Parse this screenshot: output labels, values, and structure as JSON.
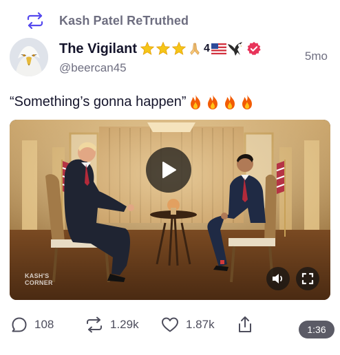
{
  "retruth": {
    "icon": "retruth-icon",
    "label": "Kash Patel ReTruthed"
  },
  "author": {
    "avatar": "eagle-avatar",
    "name": "The Vigilant",
    "name_suffix_count": "4",
    "name_emojis": [
      "star",
      "star",
      "star",
      "praying-hands",
      "us-flag",
      "eagle"
    ],
    "verified_badge_color": "#e8345a",
    "handle": "@beercan45",
    "timestamp": "5mo"
  },
  "post": {
    "text": "“Something’s gonna happen”",
    "emojis": [
      "fire",
      "fire",
      "fire",
      "fire"
    ]
  },
  "video": {
    "watermark_line1": "KASH'S",
    "watermark_line2": "CORNER",
    "duration": "1:36",
    "controls": [
      "play-icon",
      "speaker-icon",
      "fullscreen-icon"
    ]
  },
  "actions": {
    "replies": "108",
    "retruths": "1.29k",
    "likes": "1.87k"
  },
  "colors": {
    "text": "#14142b",
    "muted": "#6e6e80",
    "accent": "#5448ee",
    "star": "#f5b800",
    "fire": "#f25c05"
  }
}
